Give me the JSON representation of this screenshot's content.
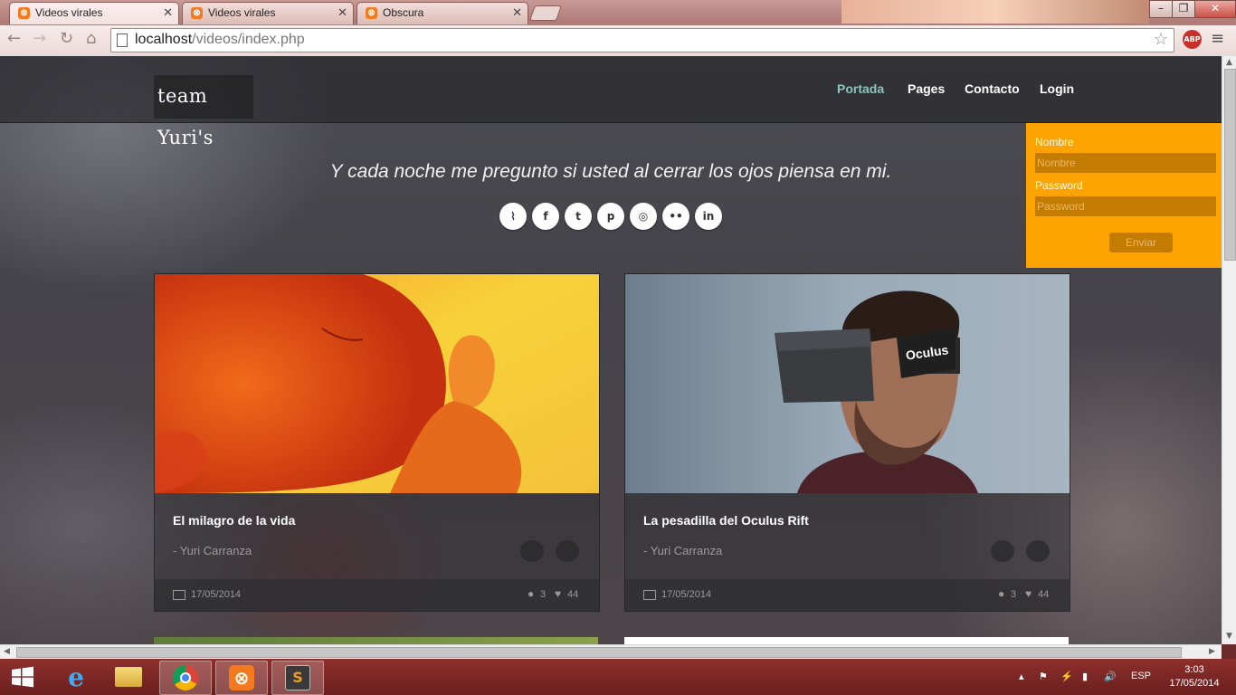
{
  "browser": {
    "tabs": [
      {
        "title": "Videos virales",
        "active": true
      },
      {
        "title": "Videos virales",
        "active": false
      },
      {
        "title": "Obscura",
        "active": false
      }
    ],
    "url_host": "localhost",
    "url_path": "/videos/index.php",
    "extension_label": "ABP",
    "window_buttons": {
      "minimize": "–",
      "maximize": "❐",
      "close": "✕"
    }
  },
  "site": {
    "logo": "team Yuri's",
    "nav": [
      {
        "label": "Portada",
        "active": true
      },
      {
        "label": "Pages",
        "active": false
      },
      {
        "label": "Contacto",
        "active": false
      },
      {
        "label": "Login",
        "active": false
      }
    ],
    "tagline": "Y cada noche me pregunto si usted al cerrar los ojos piensa en mi.",
    "social": [
      {
        "name": "rss-icon",
        "glyph": "⌇"
      },
      {
        "name": "facebook-icon",
        "glyph": "f"
      },
      {
        "name": "twitter-icon",
        "glyph": "t"
      },
      {
        "name": "pinterest-icon",
        "glyph": "p"
      },
      {
        "name": "dribbble-icon",
        "glyph": "◎"
      },
      {
        "name": "flickr-icon",
        "glyph": "••"
      },
      {
        "name": "linkedin-icon",
        "glyph": "in"
      }
    ]
  },
  "login": {
    "name_label": "Nombre",
    "name_placeholder": "Nombre",
    "password_label": "Password",
    "password_placeholder": "Password",
    "submit": "Enviar",
    "accent": "#ffa300"
  },
  "cards": [
    {
      "title": "El milagro de la vida",
      "author": "- Yuri Carranza",
      "date": "17/05/2014",
      "comments": "3",
      "likes": "44"
    },
    {
      "title": "La pesadilla del Oculus Rift",
      "author": "- Yuri Carranza",
      "date": "17/05/2014",
      "comments": "3",
      "likes": "44",
      "headset_text": "Oculus"
    }
  ],
  "taskbar": {
    "language": "ESP",
    "time": "3:03",
    "date": "17/05/2014"
  }
}
